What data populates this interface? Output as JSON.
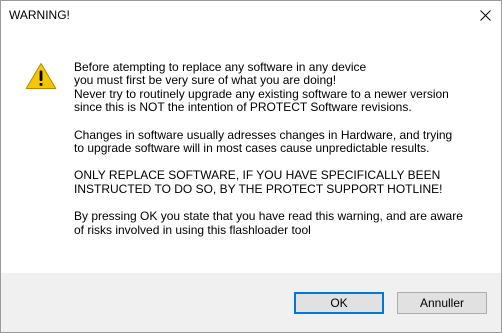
{
  "dialog": {
    "title": "WARNING!",
    "close_icon": "close-icon",
    "icon": "warning-icon",
    "colors": {
      "warning_yellow": "#f6c700",
      "footer_bg": "#f0f0f0",
      "default_button_border": "#0078d7"
    },
    "message": {
      "p1": "Before atempting to replace any software in any device\nyou must first be very sure of what you are doing!\nNever try to routinely upgrade any existing software to a newer version\nsince this is NOT the intention of PROTECT Software revisions.",
      "p2": "Changes in software usually adresses changes in Hardware, and trying\nto upgrade software will in most cases cause unpredictable results.",
      "p3": "ONLY REPLACE SOFTWARE, IF YOU HAVE SPECIFICALLY BEEN\nINSTRUCTED TO DO SO, BY THE PROTECT SUPPORT HOTLINE!",
      "p4": "By pressing OK you state that you have read this warning, and are aware\nof risks involved in using this flashloader tool"
    },
    "buttons": {
      "ok_label": "OK",
      "cancel_label": "Annuller"
    }
  }
}
